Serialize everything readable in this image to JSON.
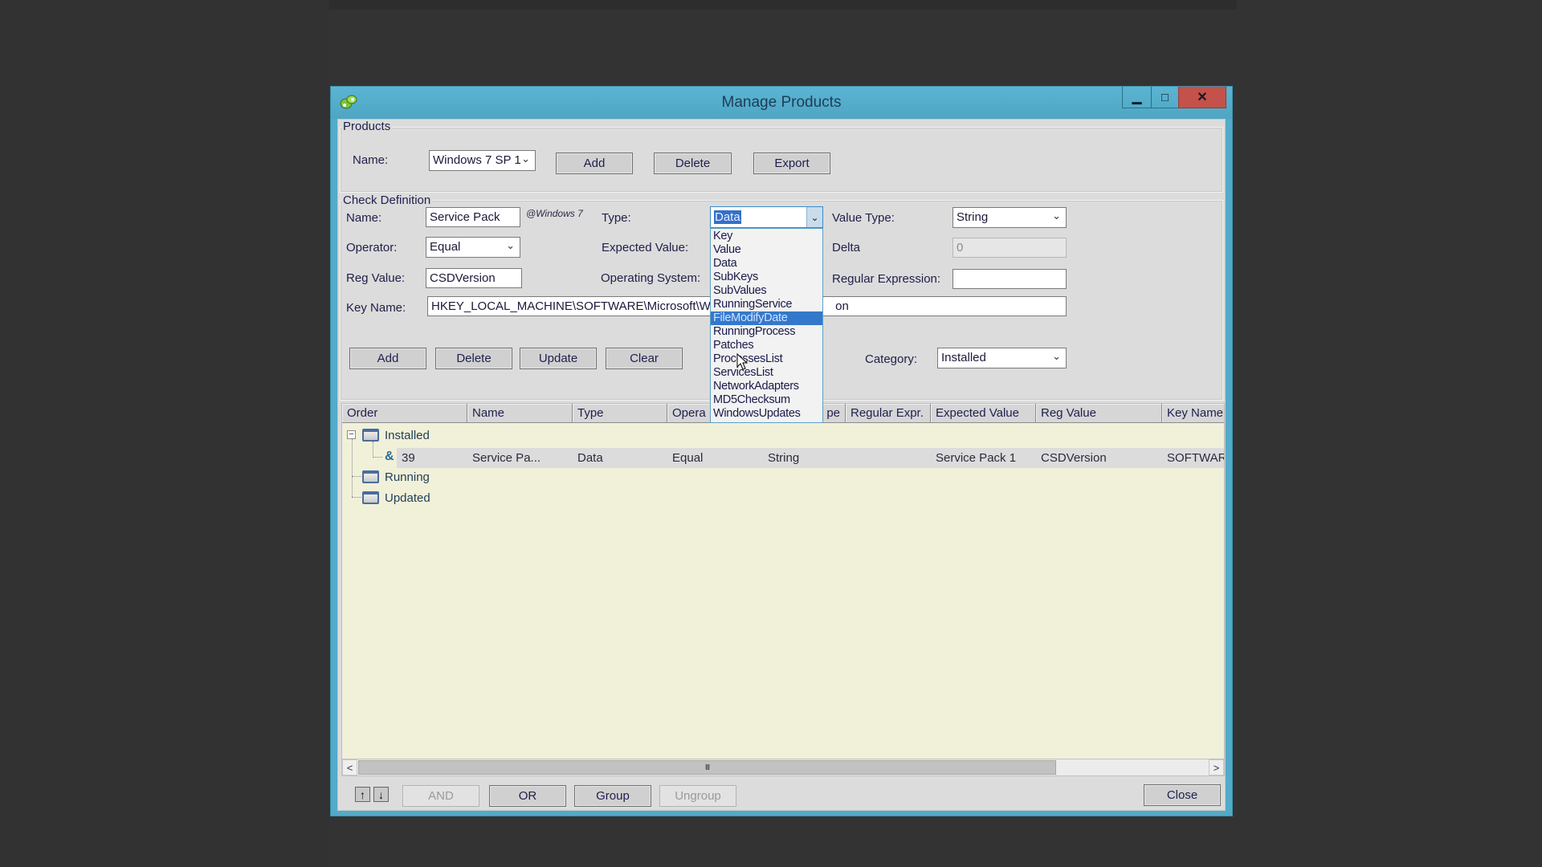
{
  "window": {
    "title": "Manage Products",
    "controls": {
      "minimize": "▁",
      "maximize": "□",
      "close": "✕"
    }
  },
  "products": {
    "group_label": "Products",
    "name_label": "Name:",
    "name_value": "Windows 7 SP 1",
    "buttons": {
      "add": "Add",
      "delete": "Delete",
      "export": "Export"
    }
  },
  "check_definition": {
    "group_label": "Check Definition",
    "name_label": "Name:",
    "name_value": "Service Pack",
    "os_tag": "@Windows 7",
    "operator_label": "Operator:",
    "operator_value": "Equal",
    "reg_value_label": "Reg Value:",
    "reg_value_value": "CSDVersion",
    "key_name_label": "Key Name:",
    "key_name_value_left": "HKEY_LOCAL_MACHINE\\SOFTWARE\\Microsoft\\Wi",
    "key_name_value_right": "on",
    "type_label": "Type:",
    "type_value": "Data",
    "type_options": [
      "Key",
      "Value",
      "Data",
      "SubKeys",
      "SubValues",
      "RunningService",
      "FileModifyDate",
      "RunningProcess",
      "Patches",
      "ProcessesList",
      "ServicesList",
      "NetworkAdapters",
      "MD5Checksum",
      "WindowsUpdates"
    ],
    "type_highlighted": "FileModifyDate",
    "expected_value_label": "Expected Value:",
    "operating_system_label": "Operating System:",
    "value_type_label": "Value Type:",
    "value_type_value": "String",
    "delta_label": "Delta",
    "delta_value": "0",
    "regex_label": "Regular Expression:",
    "regex_value": "",
    "category_label": "Category:",
    "category_value": "Installed",
    "buttons": {
      "add": "Add",
      "delete": "Delete",
      "update": "Update",
      "clear": "Clear"
    }
  },
  "grid": {
    "columns": [
      "Order",
      "Name",
      "Type",
      "Opera",
      "pe",
      "Regular Expr.",
      "Expected Value",
      "Reg Value",
      "Key Name"
    ],
    "groups": [
      {
        "label": "Installed",
        "expanded": true
      },
      {
        "label": "Running",
        "expanded": false
      },
      {
        "label": "Updated",
        "expanded": false
      }
    ],
    "rows": [
      {
        "logic": "&",
        "order": "39",
        "name": "Service Pa...",
        "type": "Data",
        "operator": "Equal",
        "value_type": "String",
        "regex": "",
        "expected_value": "Service Pack 1",
        "reg_value": "CSDVersion",
        "key_name": "SOFTWAR"
      }
    ],
    "scrollbar": {
      "left": "<",
      "right": ">",
      "grip": "III"
    }
  },
  "bottom": {
    "move_up": "↑",
    "move_down": "↓",
    "and": "AND",
    "or": "OR",
    "group": "Group",
    "ungroup": "Ungroup",
    "close": "Close"
  }
}
